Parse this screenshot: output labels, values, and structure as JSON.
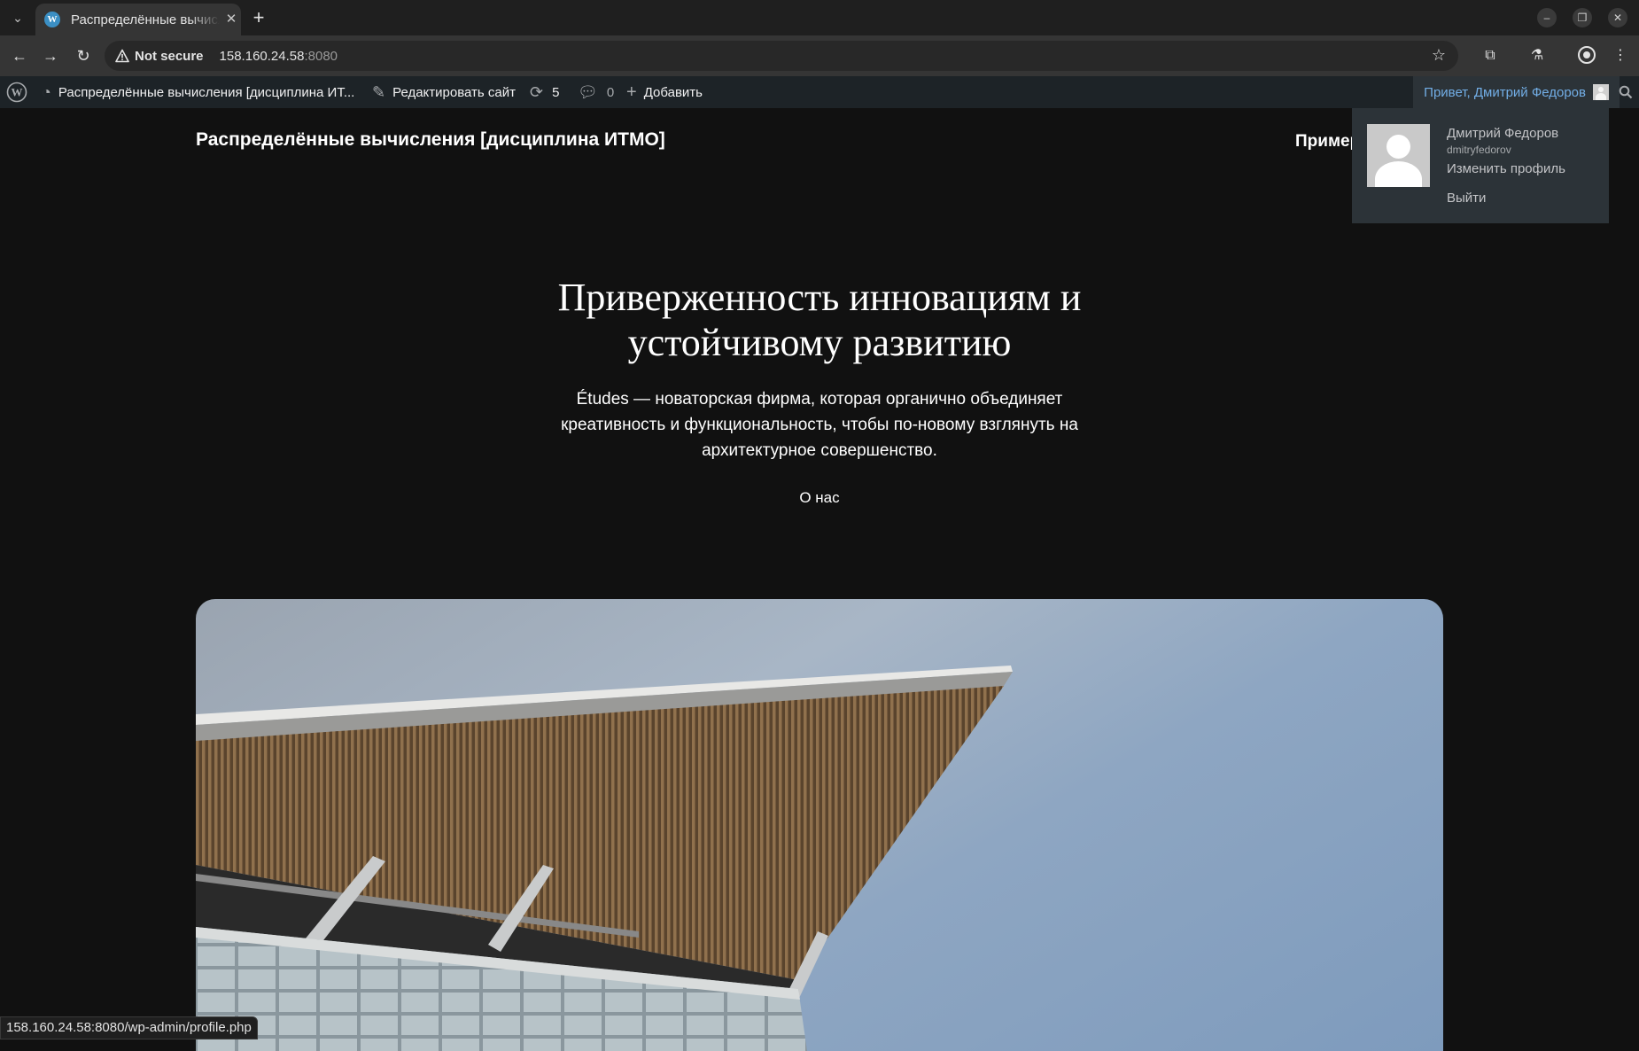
{
  "browser": {
    "tab_title": "Распределённые вычисления [дисциплина ИТМО]",
    "security_label": "Not secure",
    "url_host": "158.160.24.58",
    "url_port": ":8080",
    "status_url": "158.160.24.58:8080/wp-admin/profile.php"
  },
  "adminbar": {
    "site_name": "Распределённые вычисления [дисциплина ИТ...",
    "customize": "Редактировать сайт",
    "updates_count": "5",
    "comments_count": "0",
    "new_content": "Добавить",
    "greeting": "Привет, Дмитрий Федоров"
  },
  "account_menu": {
    "display_name": "Дмитрий Федоров",
    "username": "dmitryfedorov",
    "edit_profile": "Изменить профиль",
    "logout": "Выйти"
  },
  "site": {
    "title": "Распределённые вычисления [дисциплина ИТМО]",
    "nav_item": "Пример",
    "hero_heading": "Приверженность инновациям и устойчивому развитию",
    "hero_text": "Études — новаторская фирма, которая органично объединяет креативность и функциональность, чтобы по-новому взглянуть на архитектурное совершенство.",
    "about_link": "О нас"
  },
  "colors": {
    "page_bg": "#111111",
    "adminbar_bg": "#1d2327",
    "link_blue": "#72aee6"
  }
}
